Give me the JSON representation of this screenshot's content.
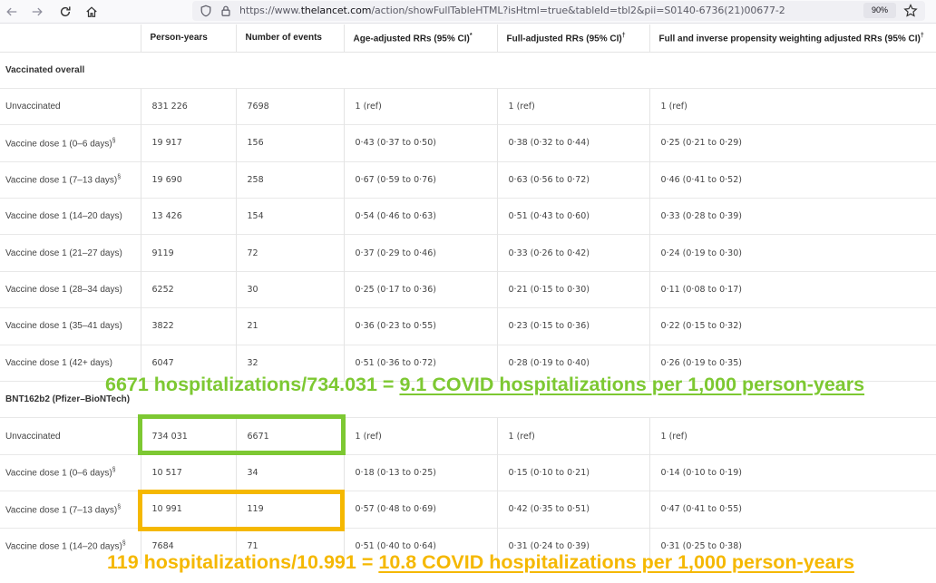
{
  "browser": {
    "url_prefix": "https://www.",
    "url_host": "thelancet.com",
    "url_rest": "/action/showFullTableHTML?isHtml=true&tableId=tbl2&pii=S0140-6736(21)00677-2",
    "zoom": "90%"
  },
  "table": {
    "headers": {
      "label": "",
      "person_years": "Person-years",
      "events": "Number of events",
      "age_adj": "Age-adjusted RRs (95% CI)",
      "age_adj_mark": "*",
      "full_adj": "Full-adjusted RRs (95% CI)",
      "full_adj_mark": "†",
      "full_ipw": "Full and inverse propensity weighting adjusted RRs (95% CI)",
      "full_ipw_mark": "†"
    },
    "sections": [
      {
        "title": "Vaccinated overall",
        "rows": [
          {
            "label": "Unvaccinated",
            "mark": "",
            "py": "831 226",
            "ev": "7698",
            "a": "1 (ref)",
            "f": "1 (ref)",
            "w": "1 (ref)"
          },
          {
            "label": "Vaccine dose 1 (0–6 days)",
            "mark": "§",
            "py": "19 917",
            "ev": "156",
            "a": "0·43 (0·37 to 0·50)",
            "f": "0·38 (0·32 to 0·44)",
            "w": "0·25 (0·21 to 0·29)"
          },
          {
            "label": "Vaccine dose 1 (7–13 days)",
            "mark": "§",
            "py": "19 690",
            "ev": "258",
            "a": "0·67 (0·59 to 0·76)",
            "f": "0·63 (0·56 to 0·72)",
            "w": "0·46 (0·41 to 0·52)"
          },
          {
            "label": "Vaccine dose 1 (14–20 days)",
            "mark": "",
            "py": "13 426",
            "ev": "154",
            "a": "0·54 (0·46 to 0·63)",
            "f": "0·51 (0·43 to 0·60)",
            "w": "0·33 (0·28 to 0·39)"
          },
          {
            "label": "Vaccine dose 1 (21–27 days)",
            "mark": "",
            "py": "9119",
            "ev": "72",
            "a": "0·37 (0·29 to 0·46)",
            "f": "0·33 (0·26 to 0·42)",
            "w": "0·24 (0·19 to 0·30)"
          },
          {
            "label": "Vaccine dose 1 (28–34 days)",
            "mark": "",
            "py": "6252",
            "ev": "30",
            "a": "0·25 (0·17 to 0·36)",
            "f": "0·21 (0·15 to 0·30)",
            "w": "0·11 (0·08 to 0·17)"
          },
          {
            "label": "Vaccine dose 1 (35–41 days)",
            "mark": "",
            "py": "3822",
            "ev": "21",
            "a": "0·36 (0·23 to 0·55)",
            "f": "0·23 (0·15 to 0·36)",
            "w": "0·22 (0·15 to 0·32)"
          },
          {
            "label": "Vaccine dose 1 (42+ days)",
            "mark": "",
            "py": "6047",
            "ev": "32",
            "a": "0·51 (0·36 to 0·72)",
            "f": "0·28 (0·19 to 0·40)",
            "w": "0·26 (0·19 to 0·35)"
          }
        ]
      },
      {
        "title": "BNT162b2 (Pfizer–BioNTech)",
        "rows": [
          {
            "label": "Unvaccinated",
            "mark": "",
            "py": "734 031",
            "ev": "6671",
            "a": "1 (ref)",
            "f": "1 (ref)",
            "w": "1 (ref)"
          },
          {
            "label": "Vaccine dose 1 (0–6 days)",
            "mark": "§",
            "py": "10 517",
            "ev": "34",
            "a": "0·18 (0·13 to 0·25)",
            "f": "0·15 (0·10 to 0·21)",
            "w": "0·14 (0·10 to 0·19)"
          },
          {
            "label": "Vaccine dose 1 (7–13 days)",
            "mark": "§",
            "py": "10 991",
            "ev": "119",
            "a": "0·57 (0·48 to 0·69)",
            "f": "0·42 (0·35 to 0·51)",
            "w": "0·47 (0·41 to 0·55)"
          },
          {
            "label": "Vaccine dose 1 (14–20 days)",
            "mark": "§",
            "py": "7684",
            "ev": "71",
            "a": "0·51 (0·40 to 0·64)",
            "f": "0·31 (0·24 to 0·39)",
            "w": "0·31 (0·25 to 0·38)"
          }
        ]
      }
    ]
  },
  "annotations": {
    "green": {
      "color": "#7dc832",
      "prefix": "6671 hospitalizations/734.031 = ",
      "highlight": "9.1 COVID hospitalizations per 1,000 person-years"
    },
    "orange": {
      "color": "#f5b800",
      "prefix": "119 hospitalizations/10.991 = ",
      "highlight": "10.8 COVID hospitalizations per 1,000 person-years"
    }
  }
}
